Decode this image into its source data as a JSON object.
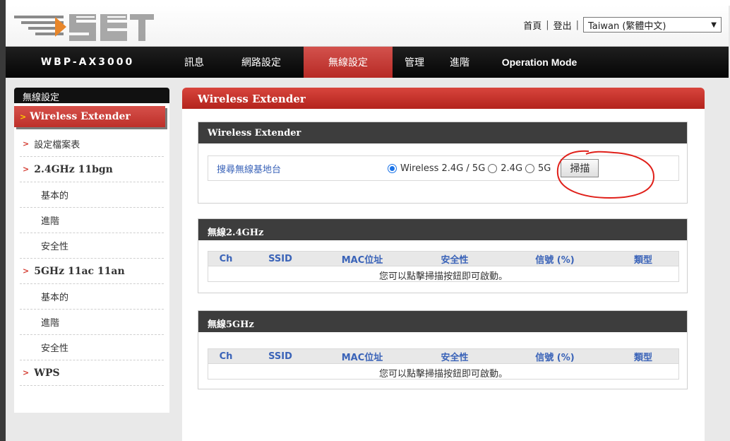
{
  "header": {
    "links": [
      "首頁",
      "登出"
    ],
    "language": "Taiwan (繁體中文)"
  },
  "nav": {
    "model": "WBP-AX3000",
    "items": [
      {
        "label": "訊息",
        "active": false
      },
      {
        "label": "網路設定",
        "active": false
      },
      {
        "label": "無線設定",
        "active": true
      },
      {
        "label": "管理",
        "active": false
      },
      {
        "label": "進階",
        "active": false
      },
      {
        "label": "Operation Mode",
        "active": false
      }
    ]
  },
  "sidebar": {
    "title": "無線設定",
    "items": [
      {
        "label": "Wireless Extender",
        "type": "selected"
      },
      {
        "label": "設定檔案表",
        "type": "top"
      },
      {
        "label": "2.4GHz 11bgn",
        "type": "top-bold"
      },
      {
        "label": "基本的",
        "type": "sub"
      },
      {
        "label": "進階",
        "type": "sub"
      },
      {
        "label": "安全性",
        "type": "sub"
      },
      {
        "label": "5GHz 11ac 11an",
        "type": "top-bold"
      },
      {
        "label": "基本的",
        "type": "sub"
      },
      {
        "label": "進階",
        "type": "sub"
      },
      {
        "label": "安全性",
        "type": "sub"
      },
      {
        "label": "WPS",
        "type": "top-bold"
      }
    ]
  },
  "main": {
    "title": "Wireless Extender",
    "extender_panel": {
      "title": "Wireless Extender",
      "scan_label": "搜尋無線基地台",
      "options": [
        "Wireless 2.4G / 5G",
        "2.4G",
        "5G"
      ],
      "selected_option": "Wireless 2.4G / 5G",
      "scan_button": "掃描"
    },
    "panel_24": {
      "title": "無線2.4GHz",
      "columns": [
        "Ch",
        "SSID",
        "MAC位址",
        "安全性",
        "信號 (%)",
        "類型"
      ],
      "message": "您可以點擊掃描按鈕即可啟動。"
    },
    "panel_5": {
      "title": "無線5GHz",
      "columns": [
        "Ch",
        "SSID",
        "MAC位址",
        "安全性",
        "信號 (%)",
        "類型"
      ],
      "message": "您可以點擊掃描按鈕即可啟動。"
    }
  },
  "colors": {
    "accent_red": "#c0352e",
    "link_blue": "#3a63b8",
    "annotation_red": "#e0201a"
  }
}
